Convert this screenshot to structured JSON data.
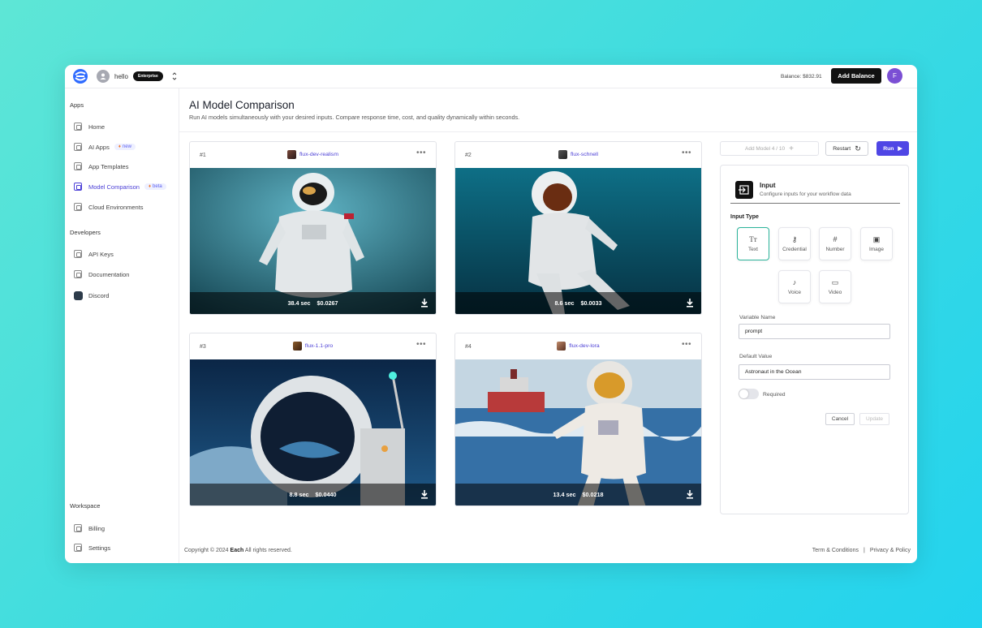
{
  "topbar": {
    "user_name": "hello",
    "plan_badge": "Enterprise",
    "balance": "Balance: $832.91",
    "add_balance": "Add Balance",
    "profile_initial": "F"
  },
  "sidebar": {
    "apps_title": "Apps",
    "apps_items": [
      {
        "label": "Home"
      },
      {
        "label": "AI Apps",
        "tag": "new"
      },
      {
        "label": "App Templates"
      },
      {
        "label": "Model Comparison",
        "tag": "beta",
        "active": true
      },
      {
        "label": "Cloud Environments"
      }
    ],
    "developers_title": "Developers",
    "developers_items": [
      {
        "label": "API Keys"
      },
      {
        "label": "Documentation"
      },
      {
        "label": "Discord"
      }
    ],
    "workspace_title": "Workspace",
    "workspace_items": [
      {
        "label": "Billing"
      },
      {
        "label": "Settings"
      }
    ]
  },
  "header": {
    "title": "AI Model Comparison",
    "subtitle": "Run AI models simultaneously with your desired inputs. Compare response time, cost, and quality dynamically within seconds."
  },
  "cards": [
    {
      "num": "#1",
      "model": "flux-dev-realism",
      "time": "38.4 sec",
      "cost": "$0.0267"
    },
    {
      "num": "#2",
      "model": "flux-schnell",
      "time": "8.6 sec",
      "cost": "$0.0033"
    },
    {
      "num": "#3",
      "model": "flux-1.1-pro",
      "time": "8.8 sec",
      "cost": "$0.0440"
    },
    {
      "num": "#4",
      "model": "flux-dev-lora",
      "time": "13.4 sec",
      "cost": "$0.0218"
    }
  ],
  "actions": {
    "add_model": "Add Model 4 / 10",
    "restart": "Restart",
    "run": "Run"
  },
  "panel": {
    "title": "Input",
    "subtitle": "Configure inputs for your workflow data",
    "input_type_label": "Input Type",
    "types": [
      "Text",
      "Credential",
      "Number",
      "Image",
      "Voice",
      "Video"
    ],
    "selected_type": "Text",
    "variable_name_label": "Variable Name",
    "variable_name_value": "prompt",
    "default_value_label": "Default Value",
    "default_value_value": "Astronaut in the Ocean",
    "required_label": "Required",
    "required": false,
    "cancel": "Cancel",
    "update": "Update"
  },
  "footer": {
    "copyright_prefix": "Copyright © 2024",
    "brand": "Each",
    "copyright_suffix": "All rights reserved.",
    "terms": "Term & Conditions",
    "separator": "|",
    "privacy": "Privacy & Policy"
  }
}
